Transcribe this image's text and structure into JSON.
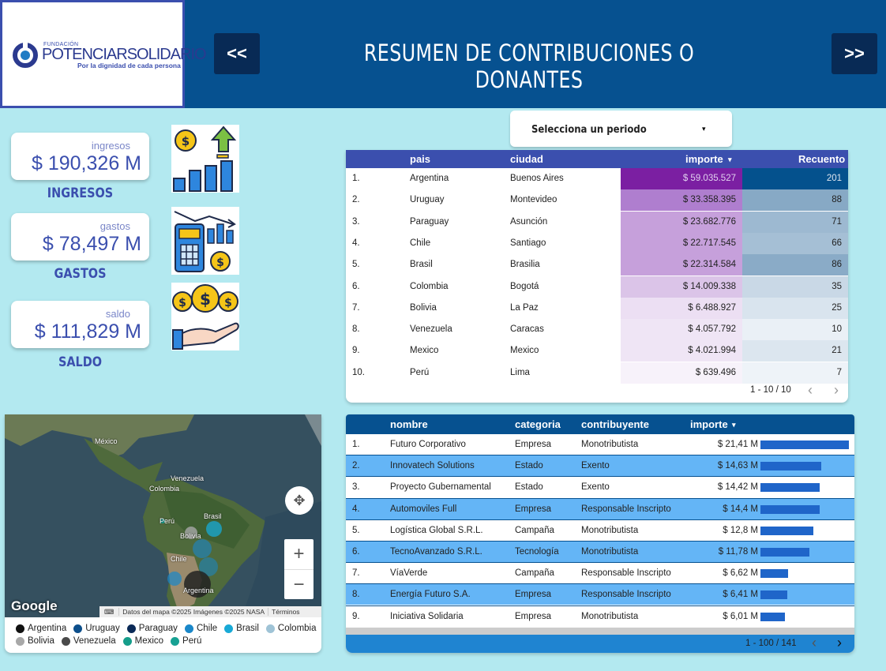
{
  "header": {
    "logo_small": "FUNDACIÓN",
    "logo_brand_a": "POTENCIAR",
    "logo_brand_b": "SOLIDARIO",
    "logo_tagline": "Por la dignidad de cada persona",
    "prev_label": "<<",
    "next_label": ">>",
    "title": "RESUMEN DE CONTRIBUCIONES O DONANTES"
  },
  "kpis": [
    {
      "label": "ingresos",
      "value": "$ 190,326 M",
      "caption": "INGRESOS"
    },
    {
      "label": "gastos",
      "value": "$ 78,497 M",
      "caption": "GASTOS"
    },
    {
      "label": "saldo",
      "value": "$ 111,829 M",
      "caption": "SALDO"
    }
  ],
  "period": {
    "label": "Selecciona un periodo",
    "caret": "▾"
  },
  "country_table": {
    "headers": {
      "pais": "pais",
      "ciudad": "ciudad",
      "importe": "importe",
      "sort": "▾",
      "recuento": "Recuento"
    },
    "rows": [
      {
        "n": "1.",
        "pais": "Argentina",
        "ciudad": "Buenos Aires",
        "importe": "$ 59.035.527",
        "recuento": "201",
        "imp_bg": "#7b1fa2",
        "cnt_bg": "#04518d",
        "imp_fg": "#e0d0ee",
        "cnt_fg": "#dfe6f0"
      },
      {
        "n": "2.",
        "pais": "Uruguay",
        "ciudad": "Montevideo",
        "importe": "$ 33.358.395",
        "recuento": "88",
        "imp_bg": "#af7ecf",
        "cnt_bg": "#87a9c5",
        "imp_fg": "#222",
        "cnt_fg": "#222"
      },
      {
        "n": "3.",
        "pais": "Paraguay",
        "ciudad": "Asunción",
        "importe": "$ 23.682.776",
        "recuento": "71",
        "imp_bg": "#c6a0db",
        "cnt_bg": "#9db9d1",
        "imp_fg": "#222",
        "cnt_fg": "#222"
      },
      {
        "n": "4.",
        "pais": "Chile",
        "ciudad": "Santiago",
        "importe": "$ 22.717.545",
        "recuento": "66",
        "imp_bg": "#c6a0db",
        "cnt_bg": "#a5bfd5",
        "imp_fg": "#222",
        "cnt_fg": "#222"
      },
      {
        "n": "5.",
        "pais": "Brasil",
        "ciudad": "Brasilia",
        "importe": "$ 22.314.584",
        "recuento": "86",
        "imp_bg": "#c6a0db",
        "cnt_bg": "#8aabc7",
        "imp_fg": "#222",
        "cnt_fg": "#222"
      },
      {
        "n": "6.",
        "pais": "Colombia",
        "ciudad": "Bogotá",
        "importe": "$ 14.009.338",
        "recuento": "35",
        "imp_bg": "#dbc4e8",
        "cnt_bg": "#c9d8e6",
        "imp_fg": "#222",
        "cnt_fg": "#222"
      },
      {
        "n": "7.",
        "pais": "Bolivia",
        "ciudad": "La Paz",
        "importe": "$ 6.488.927",
        "recuento": "25",
        "imp_bg": "#ecdff3",
        "cnt_bg": "#d9e4ee",
        "imp_fg": "#222",
        "cnt_fg": "#222"
      },
      {
        "n": "8.",
        "pais": "Venezuela",
        "ciudad": "Caracas",
        "importe": "$ 4.057.792",
        "recuento": "10",
        "imp_bg": "#efe5f5",
        "cnt_bg": "#eaf0f6",
        "imp_fg": "#222",
        "cnt_fg": "#222"
      },
      {
        "n": "9.",
        "pais": "Mexico",
        "ciudad": "Mexico",
        "importe": "$ 4.021.994",
        "recuento": "21",
        "imp_bg": "#efe5f5",
        "cnt_bg": "#dce6ef",
        "imp_fg": "#222",
        "cnt_fg": "#222"
      },
      {
        "n": "10.",
        "pais": "Perú",
        "ciudad": "Lima",
        "importe": "$ 639.496",
        "recuento": "7",
        "imp_bg": "#f7f2fa",
        "cnt_bg": "#eef3f8",
        "imp_fg": "#222",
        "cnt_fg": "#222"
      }
    ],
    "pager": "1 - 10 / 10",
    "prev": "‹",
    "next": "›"
  },
  "map": {
    "labels": {
      "mexico": "México",
      "venezuela": "Venezuela",
      "colombia": "Colombia",
      "peru": "Perú",
      "brasil": "Brasil",
      "bolivia": "Bolivia",
      "chile": "Chile",
      "argentina": "Argentina"
    },
    "google": "Google",
    "attribution": "Datos del mapa ©2025 Imágenes ©2025 NASA",
    "terms": "Términos",
    "zoom_in": "+",
    "zoom_out": "−",
    "legend": [
      {
        "name": "Argentina",
        "color": "#111111"
      },
      {
        "name": "Uruguay",
        "color": "#0d4f8b"
      },
      {
        "name": "Paraguay",
        "color": "#0a2a57"
      },
      {
        "name": "Chile",
        "color": "#1a87c9"
      },
      {
        "name": "Brasil",
        "color": "#18a9d6"
      },
      {
        "name": "Colombia",
        "color": "#9fc3d6"
      },
      {
        "name": "Bolivia",
        "color": "#a8a8a8"
      },
      {
        "name": "Venezuela",
        "color": "#4a4a4a"
      },
      {
        "name": "Mexico",
        "color": "#159d8a"
      },
      {
        "name": "Perú",
        "color": "#17a193"
      }
    ]
  },
  "donor_table": {
    "headers": {
      "nombre": "nombre",
      "categoria": "categoria",
      "contribuyente": "contribuyente",
      "importe": "importe",
      "sort": "▾"
    },
    "rows": [
      {
        "n": "1.",
        "nombre": "Futuro Corporativo",
        "categoria": "Empresa",
        "contribuyente": "Monotributista",
        "importe": "$ 21,41 M",
        "value": 21.41
      },
      {
        "n": "2.",
        "nombre": "Innovatech Solutions",
        "categoria": "Estado",
        "contribuyente": "Exento",
        "importe": "$ 14,63 M",
        "value": 14.63
      },
      {
        "n": "3.",
        "nombre": "Proyecto Gubernamental",
        "categoria": "Estado",
        "contribuyente": "Exento",
        "importe": "$ 14,42 M",
        "value": 14.42
      },
      {
        "n": "4.",
        "nombre": "Automoviles Full",
        "categoria": "Empresa",
        "contribuyente": "Responsable Inscripto",
        "importe": "$ 14,4 M",
        "value": 14.4
      },
      {
        "n": "5.",
        "nombre": "Logística Global S.R.L.",
        "categoria": "Campaña",
        "contribuyente": "Monotributista",
        "importe": "$ 12,8 M",
        "value": 12.8
      },
      {
        "n": "6.",
        "nombre": "TecnoAvanzado S.R.L.",
        "categoria": "Tecnología",
        "contribuyente": "Monotributista",
        "importe": "$ 11,78 M",
        "value": 11.78
      },
      {
        "n": "7.",
        "nombre": "VíaVerde",
        "categoria": "Campaña",
        "contribuyente": "Responsable Inscripto",
        "importe": "$ 6,62 M",
        "value": 6.62
      },
      {
        "n": "8.",
        "nombre": "Energía Futuro S.A.",
        "categoria": "Empresa",
        "contribuyente": "Responsable Inscripto",
        "importe": "$ 6,41 M",
        "value": 6.41
      },
      {
        "n": "9.",
        "nombre": "Iniciativa Solidaria",
        "categoria": "Empresa",
        "contribuyente": "Monotributista",
        "importe": "$ 6,01 M",
        "value": 6.01
      }
    ],
    "row_colors": [
      "#ffffff",
      "#64b5f6"
    ],
    "bar_color": "#1f65c9",
    "pager": "1 - 100 / 141",
    "prev": "‹",
    "next": "›"
  },
  "colors": {
    "header_bg": "#065190",
    "page_bg": "#b3e9f0",
    "accent": "#3b4fae"
  }
}
